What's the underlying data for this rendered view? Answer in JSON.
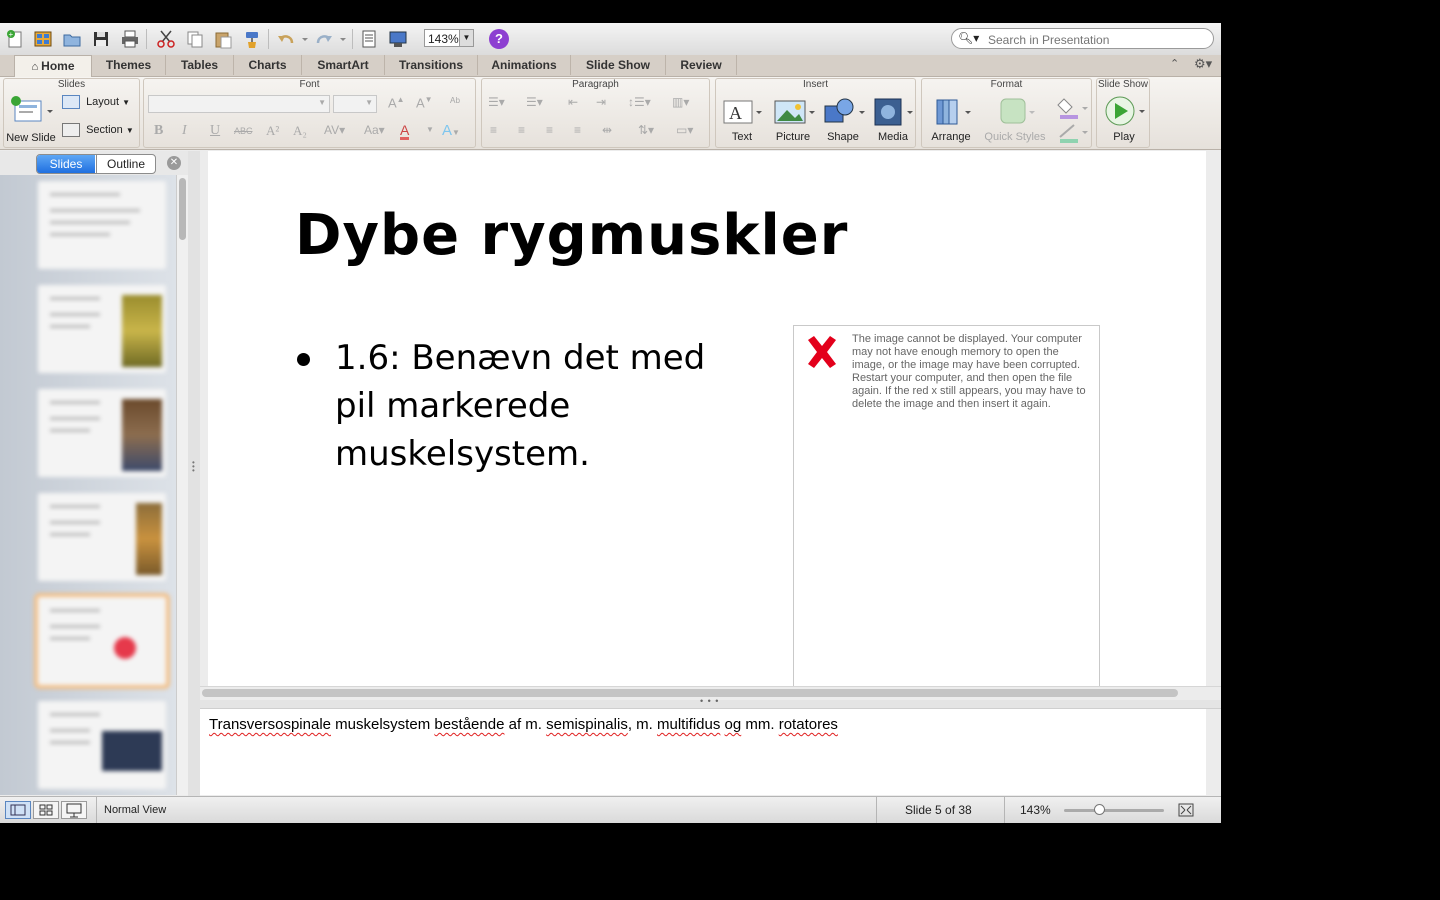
{
  "toolbar": {
    "zoom_value": "143%",
    "help_label": "?",
    "search_placeholder": "Search in Presentation"
  },
  "tabs": [
    {
      "label": "Home",
      "active": true
    },
    {
      "label": "Themes"
    },
    {
      "label": "Tables"
    },
    {
      "label": "Charts"
    },
    {
      "label": "SmartArt"
    },
    {
      "label": "Transitions"
    },
    {
      "label": "Animations"
    },
    {
      "label": "Slide Show"
    },
    {
      "label": "Review"
    }
  ],
  "ribbon": {
    "groups": {
      "slides": "Slides",
      "font": "Font",
      "paragraph": "Paragraph",
      "insert": "Insert",
      "format": "Format",
      "slide_show": "Slide Show"
    },
    "new_slide": "New Slide",
    "layout": "Layout",
    "section": "Section",
    "insert_items": [
      "Text",
      "Picture",
      "Shape",
      "Media"
    ],
    "arrange": "Arrange",
    "quick_styles": "Quick Styles",
    "play": "Play",
    "font_buttons": [
      "B",
      "I",
      "U",
      "ABC",
      "A²",
      "A₂"
    ]
  },
  "left_pane": {
    "tab_slides": "Slides",
    "tab_outline": "Outline"
  },
  "slide": {
    "title": "Dybe rygmuskler",
    "bullet": "1.6: Benævn det med pil markerede muskelsystem.",
    "image_error": "The image cannot be displayed. Your computer may not have enough memory to open the image, or the image may have been corrupted. Restart your computer, and then open the file again. If the red x still appears, you may have to delete the image and then insert it again."
  },
  "notes": {
    "parts": [
      "Transversospinale",
      " muskelsystem ",
      "bestående",
      " af m. ",
      "semispinalis",
      ", m. ",
      "multifidus",
      " ",
      "og",
      " mm. ",
      "rotatores"
    ]
  },
  "status": {
    "view_name": "Normal View",
    "slide_position": "Slide 5 of 38",
    "zoom": "143%"
  },
  "colors": {
    "accent_blue": "#1f6fe0",
    "error_red": "#e3001b",
    "help_purple": "#8d3fd1"
  }
}
